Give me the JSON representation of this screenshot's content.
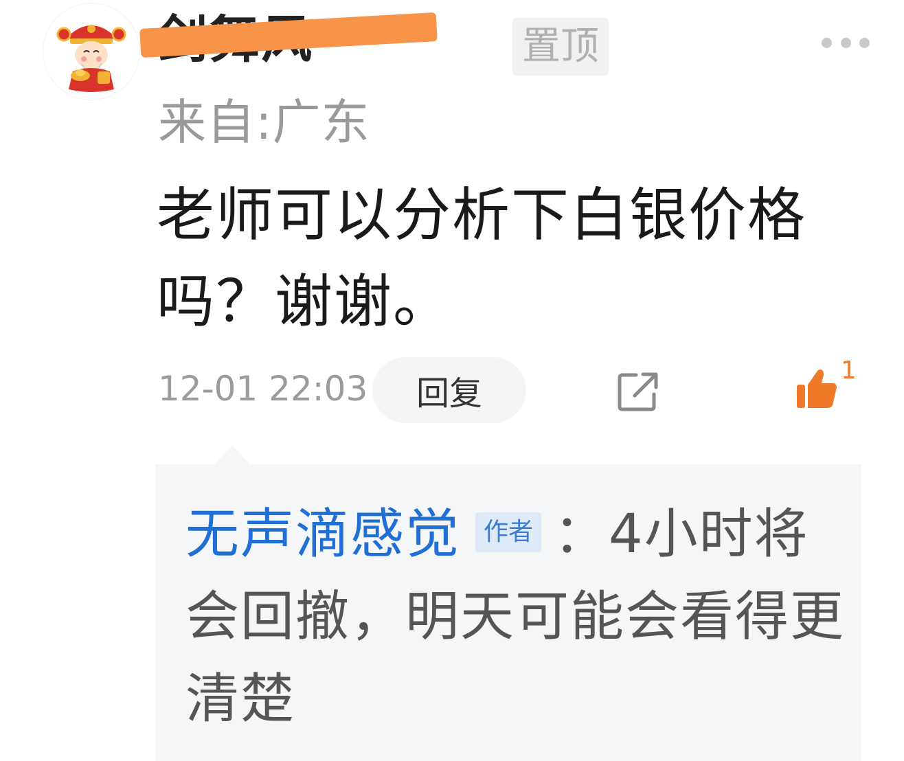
{
  "post": {
    "author": {
      "name": "剑舞风",
      "pin_label": "置顶",
      "location": "来自:广东"
    },
    "content": "老师可以分析下白银价格吗？谢谢。",
    "timestamp": "12-01 22:03",
    "reply_button_label": "回复",
    "like_count": "1",
    "accent_color": "#f07a2a"
  },
  "reply": {
    "author_name": "无声滴感觉",
    "author_tag": "作者",
    "separator": "：",
    "text": "4小时将会回撤，明天可能会看得更清楚",
    "author_color": "#1f6fd4"
  },
  "icons": {
    "avatar": "fortune-god-avatar",
    "more": "more-dots-icon",
    "share": "share-icon",
    "like": "thumbs-up-icon"
  }
}
